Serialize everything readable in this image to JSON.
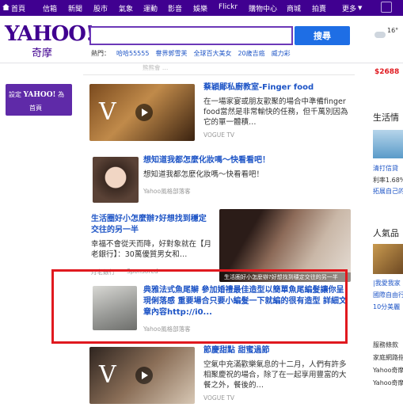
{
  "topnav": {
    "items": [
      "首頁",
      "信箱",
      "新聞",
      "股市",
      "氣象",
      "運動",
      "影音",
      "娛樂",
      "Flickr",
      "購物中心",
      "商城",
      "拍賣",
      "更多"
    ]
  },
  "header": {
    "logo": "YAHOO!",
    "logo_sub": "奇摩",
    "search_button": "搜尋",
    "search_placeholder": "",
    "hot_label": "熱門：",
    "hot_keywords": [
      "哈哈55555",
      "譽界郭雪芙",
      "全球百大美女",
      "20歲吉癌",
      "威力彩"
    ],
    "weather_temp": "16°"
  },
  "promo": {
    "line1_prefix": "設定",
    "line1_brand": "YAHOO!",
    "line1_suffix": "為",
    "line2": "首頁"
  },
  "feed": {
    "top_source": "熊熊會 …",
    "items": [
      {
        "title": "蔡穎鄖私廚教室-Finger food",
        "desc": "在一場家宴或朋友歡聚的場合中準備finger food當然是非常輸快的任務，但千萬別因為它的單一體積…",
        "source": "VOGUE TV"
      },
      {
        "title": "想知道我都怎麼化妝嗎～快看看吧！",
        "desc": "想知道我都怎麼化妝嗎～快看看吧！",
        "source": "Yahoo風格部落客"
      },
      {
        "title": "生活圈好小怎麼辦?好想找到穩定交往的另一半",
        "desc": "幸福不會從天而降，好對象就在【月老銀行】：30萬優質男女和…",
        "source": "月老銀行",
        "sponsored": "Sponsored",
        "image_caption": "生活圈好小怎麼辦?好想找到穩定交往的另一半"
      },
      {
        "title": "典雅法式魚尾辮 參加婚禮最佳造型以簡單魚尾編髮讓你呈現俐落感 重要場合只要小編髮一下就編的很有造型 詳細文章內容http://i0...",
        "source": "Yahoo風格部落客"
      },
      {
        "title": "節慶甜點 甜蜜過節",
        "desc": "空氣中充滿歡樂氣息的十二月，人們有許多相聚慶祝的場合，除了在一起享用豐富的大餐之外，餐後的…",
        "source": "VOGUE TV"
      }
    ]
  },
  "right": {
    "price": "$2688",
    "section1": "生活情",
    "links1": [
      "清打信貸",
      "利率1.68%",
      "拓展自己的"
    ],
    "section2": "人氣品",
    "links2": [
      "|我愛我家",
      "國際自由行",
      "10分美麗"
    ],
    "footer": [
      "服務條款",
      "家庭網路指",
      "Yahoo奇摩",
      "Yahoo奇摩"
    ]
  },
  "colors": {
    "brand": "#400090",
    "link": "#1d54c6",
    "highlight": "#e0191f",
    "search_button": "#1e6ee5"
  }
}
